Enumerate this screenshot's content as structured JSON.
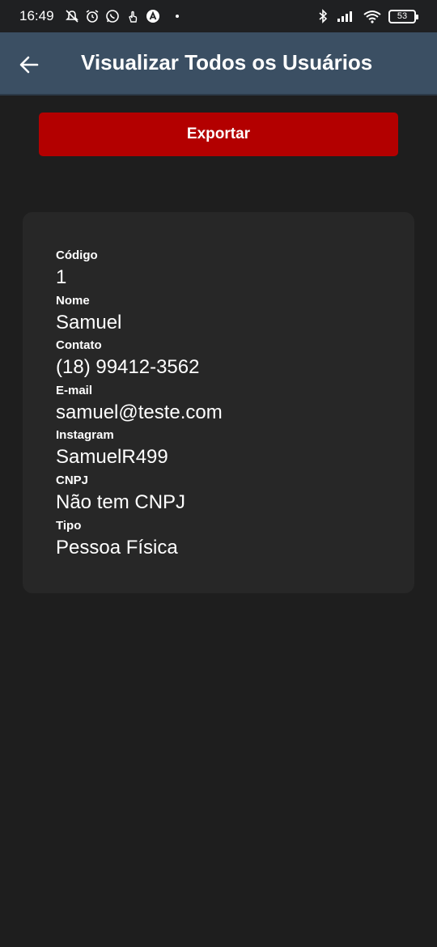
{
  "status_bar": {
    "time": "16:49",
    "battery": "53",
    "icons_left": [
      "mute-icon",
      "alarm-icon",
      "whatsapp-icon",
      "touch-icon",
      "app-a-icon"
    ],
    "icons_right": [
      "bluetooth-icon",
      "signal-icon",
      "wifi-icon",
      "battery-icon"
    ]
  },
  "app_bar": {
    "title": "Visualizar Todos os Usuários",
    "background": "#3b4f63"
  },
  "actions": {
    "export_label": "Exportar",
    "export_color": "#b30000"
  },
  "user": {
    "fields": [
      {
        "label": "Código",
        "value": "1"
      },
      {
        "label": "Nome",
        "value": "Samuel"
      },
      {
        "label": "Contato",
        "value": "(18) 99412-3562"
      },
      {
        "label": "E-mail",
        "value": "samuel@teste.com"
      },
      {
        "label": "Instagram",
        "value": "SamuelR499"
      },
      {
        "label": "CNPJ",
        "value": "Não tem CNPJ"
      },
      {
        "label": "Tipo",
        "value": "Pessoa Física"
      }
    ]
  }
}
